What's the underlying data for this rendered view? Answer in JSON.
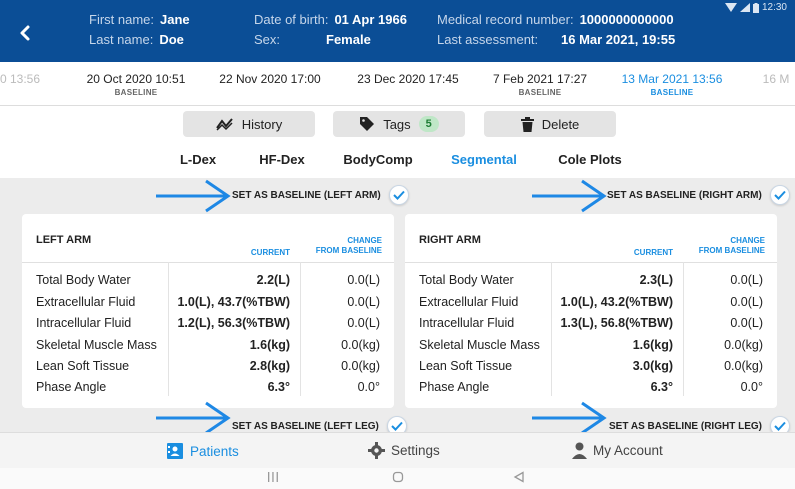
{
  "status": {
    "time": "12:30"
  },
  "header": {
    "first_name_label": "First name:",
    "first_name": "Jane",
    "last_name_label": "Last name:",
    "last_name": "Doe",
    "dob_label": "Date of birth:",
    "dob": "01 Apr 1966",
    "sex_label": "Sex:",
    "sex": "Female",
    "mrn_label": "Medical record number:",
    "mrn": "1000000000000",
    "last_assess_label": "Last assessment:",
    "last_assess": "16 Mar 2021, 19:55"
  },
  "timeline": [
    {
      "date": "0 13:56",
      "baseline": ""
    },
    {
      "date": "20 Oct 2020 10:51",
      "baseline": "BASELINE"
    },
    {
      "date": "22 Nov 2020 17:00",
      "baseline": ""
    },
    {
      "date": "23 Dec 2020 17:45",
      "baseline": ""
    },
    {
      "date": "7 Feb 2021 17:27",
      "baseline": "BASELINE"
    },
    {
      "date": "13 Mar 2021 13:56",
      "baseline": "BASELINE"
    },
    {
      "date": "16 M",
      "baseline": ""
    }
  ],
  "actions": {
    "history": "History",
    "tags": "Tags",
    "tags_count": "5",
    "delete": "Delete"
  },
  "tabs": [
    "L-Dex",
    "HF-Dex",
    "BodyComp",
    "Segmental",
    "Cole Plots"
  ],
  "active_tab": "Segmental",
  "baseline_buttons": {
    "left_arm": "SET AS BASELINE (LEFT ARM)",
    "right_arm": "SET AS BASELINE (RIGHT ARM)",
    "left_leg": "SET AS BASELINE (LEFT LEG)",
    "right_leg": "SET AS BASELINE (RIGHT LEG)"
  },
  "left_arm": {
    "title": "LEFT ARM",
    "current_header": "CURRENT",
    "change_header_1": "CHANGE",
    "change_header_2": "FROM BASELINE",
    "rows": [
      {
        "label": "Total Body Water",
        "current": "2.2(L)",
        "change": "0.0(L)"
      },
      {
        "label": "Extracellular Fluid",
        "current": "1.0(L), 43.7(%TBW)",
        "change": "0.0(L)"
      },
      {
        "label": "Intracellular Fluid",
        "current": "1.2(L), 56.3(%TBW)",
        "change": "0.0(L)"
      },
      {
        "label": "Skeletal Muscle Mass",
        "current": "1.6(kg)",
        "change": "0.0(kg)"
      },
      {
        "label": "Lean Soft Tissue",
        "current": "2.8(kg)",
        "change": "0.0(kg)"
      },
      {
        "label": "Phase Angle",
        "current": "6.3°",
        "change": "0.0°"
      }
    ]
  },
  "right_arm": {
    "title": "RIGHT ARM",
    "current_header": "CURRENT",
    "change_header_1": "CHANGE",
    "change_header_2": "FROM BASELINE",
    "rows": [
      {
        "label": "Total Body Water",
        "current": "2.3(L)",
        "change": "0.0(L)"
      },
      {
        "label": "Extracellular Fluid",
        "current": "1.0(L), 43.2(%TBW)",
        "change": "0.0(L)"
      },
      {
        "label": "Intracellular Fluid",
        "current": "1.3(L), 56.8(%TBW)",
        "change": "0.0(L)"
      },
      {
        "label": "Skeletal Muscle Mass",
        "current": "1.6(kg)",
        "change": "0.0(kg)"
      },
      {
        "label": "Lean Soft Tissue",
        "current": "3.0(kg)",
        "change": "0.0(kg)"
      },
      {
        "label": "Phase Angle",
        "current": "6.3°",
        "change": "0.0°"
      }
    ]
  },
  "bottom_nav": {
    "patients": "Patients",
    "settings": "Settings",
    "account": "My Account"
  },
  "colors": {
    "header": "#0b4e96",
    "accent": "#1a8ee0",
    "arrow": "#1e88e5"
  }
}
